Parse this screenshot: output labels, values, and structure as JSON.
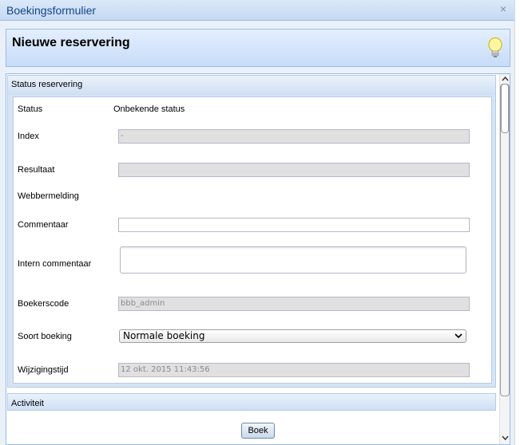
{
  "window": {
    "title": "Boekingsformulier",
    "close_label": "×"
  },
  "header": {
    "title": "Nieuwe reservering"
  },
  "status_section": {
    "title": "Status reservering",
    "fields": {
      "status": {
        "label": "Status",
        "value": "Onbekende status"
      },
      "index": {
        "label": "Index",
        "value": "-"
      },
      "resultaat": {
        "label": "Resultaat",
        "value": ""
      },
      "webbermelding": {
        "label": "Webbermelding"
      },
      "commentaar": {
        "label": "Commentaar",
        "value": ""
      },
      "intern_commentaar": {
        "label": "Intern commentaar",
        "value": ""
      },
      "boekerscode": {
        "label": "Boekerscode",
        "value": "bbb_admin"
      },
      "soort_boeking": {
        "label": "Soort boeking",
        "selected": "Normale boeking"
      },
      "wijzigingstijd": {
        "label": "Wijzigingstijd",
        "value": "12 okt. 2015 11:43:56"
      }
    }
  },
  "activity_section": {
    "title": "Activiteit"
  },
  "footer": {
    "book_label": "Boek"
  },
  "icons": {
    "hint": "lightbulb-icon",
    "close": "close-icon"
  },
  "colors": {
    "accent": "#99bbe8",
    "title_text": "#15428b",
    "readonly_bg": "#e0e0e0"
  }
}
